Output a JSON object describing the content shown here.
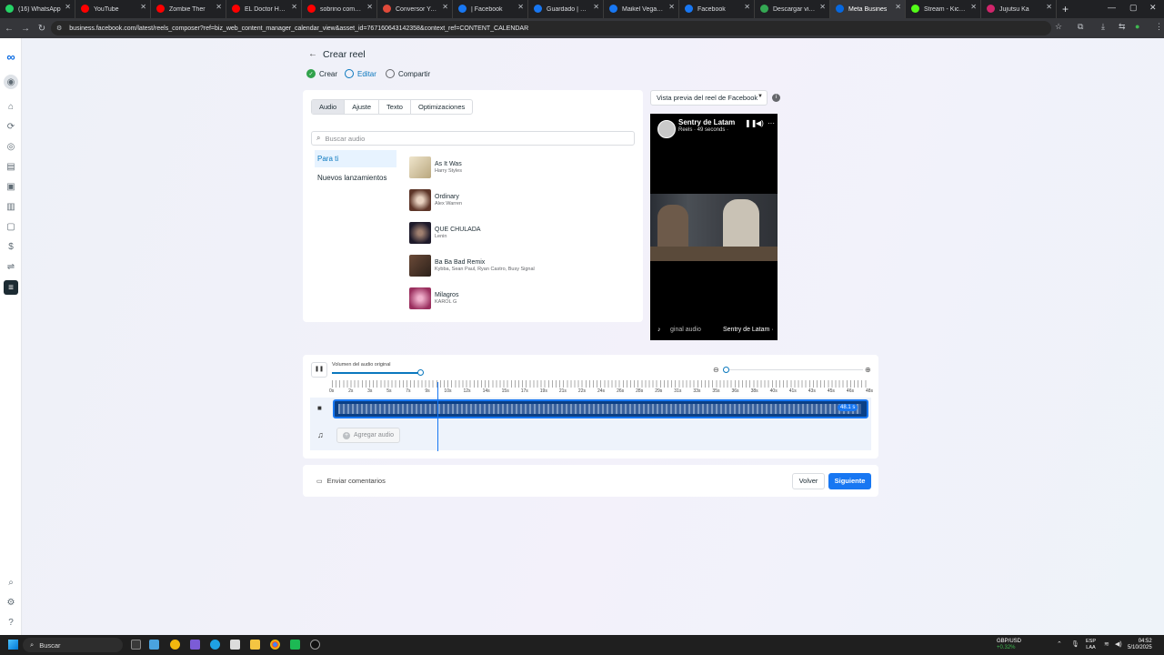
{
  "browser": {
    "tabs": [
      {
        "label": "(16) WhatsApp",
        "color": "#25d366",
        "active": false
      },
      {
        "label": "YouTube",
        "color": "#ff0000",
        "active": false
      },
      {
        "label": "Zombie Ther",
        "color": "#ff0000",
        "active": false
      },
      {
        "label": "EL Doctor House",
        "color": "#ff0000",
        "active": false
      },
      {
        "label": "sobrino combina",
        "color": "#ff0000",
        "active": false
      },
      {
        "label": "Conversor YouT",
        "color": "#e04a3a",
        "active": false
      },
      {
        "label": "| Facebook",
        "color": "#1877f2",
        "active": false
      },
      {
        "label": "Guardado | Face",
        "color": "#1877f2",
        "active": false
      },
      {
        "label": "Maikel Vegas Re",
        "color": "#1877f2",
        "active": false
      },
      {
        "label": "Facebook",
        "color": "#1877f2",
        "active": false
      },
      {
        "label": "Descargar video",
        "color": "#34a853",
        "active": false
      },
      {
        "label": "Meta Busines",
        "color": "#0668e1",
        "active": true
      },
      {
        "label": "Stream - Kick Da",
        "color": "#53fc18",
        "active": false
      },
      {
        "label": "Jujutsu Ka",
        "color": "#d1256b",
        "active": false
      }
    ],
    "url": "business.facebook.com/latest/reels_composer?ref=biz_web_content_manager_calendar_view&asset_id=767160643142358&context_ref=CONTENT_CALENDAR"
  },
  "header": {
    "back_icon": "arrow-left-icon",
    "title": "Crear reel",
    "steps": [
      {
        "label": "Crear",
        "state": "done"
      },
      {
        "label": "Editar",
        "state": "active"
      },
      {
        "label": "Compartir",
        "state": "pending"
      }
    ]
  },
  "editor": {
    "tabs": [
      "Audio",
      "Ajuste",
      "Texto",
      "Optimizaciones"
    ],
    "selected_tab": "Audio",
    "search_placeholder": "Buscar audio",
    "categories": [
      "Para ti",
      "Nuevos lanzamientos"
    ],
    "selected_category": "Para ti",
    "tracks": [
      {
        "title": "As It Was",
        "artist": "Harry Styles",
        "color": "#d9cbb0"
      },
      {
        "title": "Ordinary",
        "artist": "Alex Warren",
        "color": "#7a5040"
      },
      {
        "title": "QUE CHULADA",
        "artist": "Lenin",
        "color": "#2a2a3a"
      },
      {
        "title": "Ba Ba Bad Remix",
        "artist": "Kybba, Sean Paul, Ryan Castro, Busy Signal",
        "color": "#4e3a30"
      },
      {
        "title": "Milagros",
        "artist": "KAROL G",
        "color": "#c05a86"
      }
    ]
  },
  "preview": {
    "select_label": "Vista previa del reel de Facebook",
    "page_name": "Sentry de Latam",
    "meta": "Reels · 49 seconds · ",
    "audio_label": "ginal audio",
    "owner": "Sentry de Latam ·"
  },
  "timeline": {
    "volume_label": "Volumen del audio original",
    "volume_level": 1.0,
    "ticks": [
      "0s",
      "2s",
      "3s",
      "5s",
      "7s",
      "9s",
      "10s",
      "12s",
      "14s",
      "15s",
      "17s",
      "19s",
      "21s",
      "22s",
      "24s",
      "26s",
      "28s",
      "29s",
      "31s",
      "33s",
      "35s",
      "36s",
      "38s",
      "40s",
      "41s",
      "43s",
      "45s",
      "46s",
      "48s"
    ],
    "clip_duration": "48.1 s",
    "add_audio_label": "Agregar audio"
  },
  "footer": {
    "feedback_label": "Enviar comentarios",
    "back_label": "Volver",
    "next_label": "Siguiente"
  },
  "taskbar": {
    "search_label": "Buscar",
    "fx_pair": "GBP/USD",
    "fx_change": "+0.32%",
    "lang_top": "ESP",
    "lang_bottom": "LAA",
    "time": "04:52",
    "date": "5/10/2025"
  }
}
